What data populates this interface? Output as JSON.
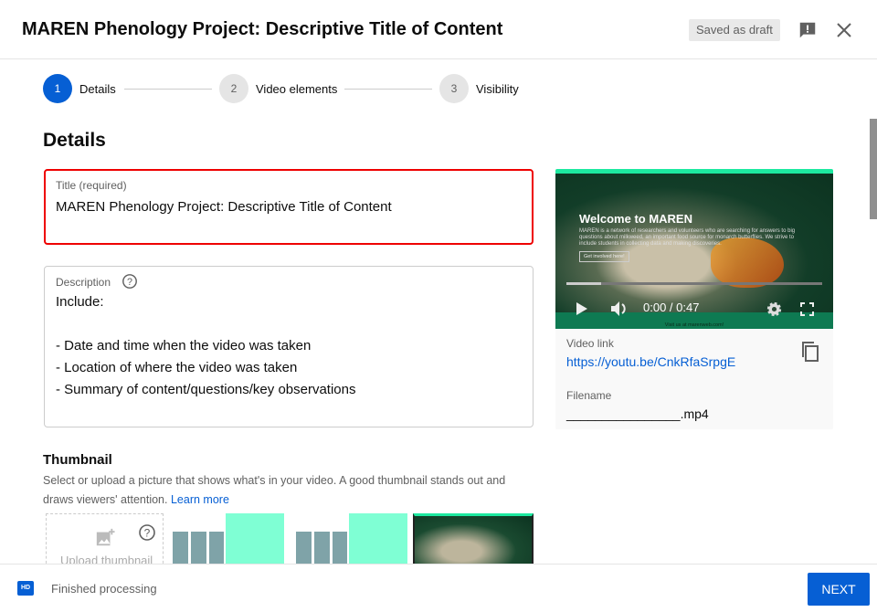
{
  "header": {
    "title": "MAREN Phenology Project: Descriptive Title of Content",
    "draft_badge": "Saved as draft"
  },
  "stepper": [
    {
      "num": "1",
      "label": "Details",
      "active": true
    },
    {
      "num": "2",
      "label": "Video elements"
    },
    {
      "num": "3",
      "label": "Visibility"
    }
  ],
  "details": {
    "heading": "Details",
    "title_label": "Title (required)",
    "title_value": "MAREN Phenology Project: Descriptive Title of Content",
    "desc_label": "Description",
    "desc_value": "Include:\n\n- Date and time when the video was taken\n- Location of where the video was taken\n- Summary of content/questions/key observations"
  },
  "thumbnail": {
    "heading": "Thumbnail",
    "text": "Select or upload a picture that shows what's in your video. A good thumbnail stands out and draws viewers' attention.",
    "learn_more": "Learn more",
    "upload_label": "Upload thumbnail"
  },
  "preview": {
    "video_title": "Welcome to MAREN",
    "video_subtitle": "MAREN is a network of researchers and volunteers who are searching for answers to big questions about milkweed, an important food source for monarch butterflies. We strive to include students in collecting data and making discoveries.",
    "video_button": "Get involved here!",
    "time": "0:00 / 0:47",
    "progress_percent": 0,
    "footer_text": "Visit us at marenweb.com!",
    "link_label": "Video link",
    "link": "https://youtu.be/CnkRfaSrpgE",
    "filename_label": "Filename",
    "filename": "________________.mp4"
  },
  "footer": {
    "hd_badge": "HD",
    "status": "Finished processing",
    "next_label": "NEXT"
  },
  "colors": {
    "accent": "#065fd4",
    "error": "#e00000"
  }
}
